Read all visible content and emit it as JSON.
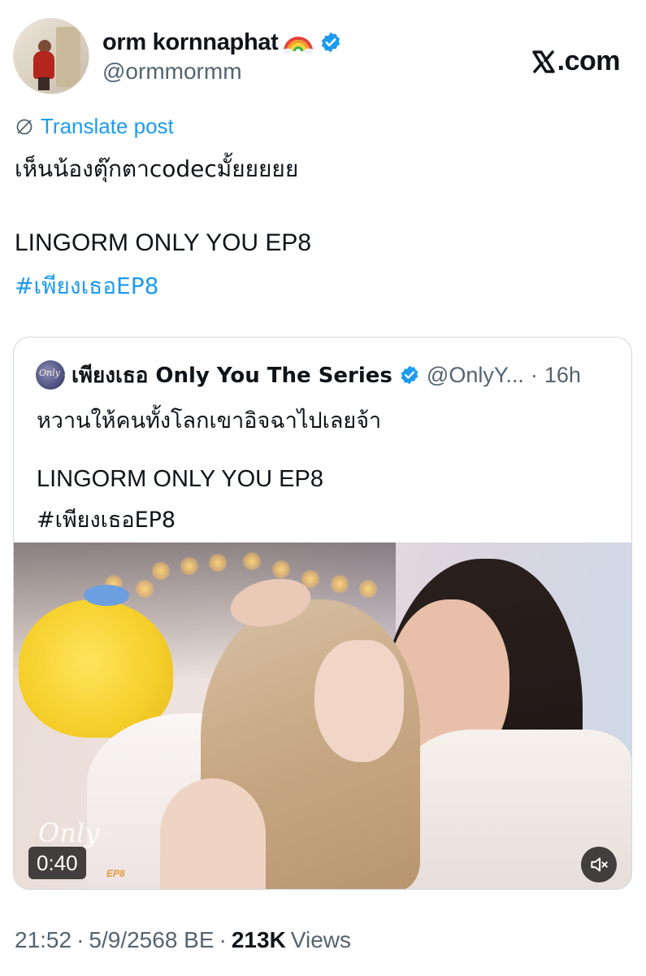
{
  "author": {
    "display_name": "orm kornnaphat",
    "handle": "@ormmormm",
    "emoji": "rainbow-flag",
    "verified": true
  },
  "brand": {
    "text": ".com",
    "logo": "x-logo-icon"
  },
  "translate": {
    "label": "Translate post",
    "icon": "globe-icon"
  },
  "post": {
    "line1": "เห็นน้องตุ๊กตาcodecมั้ยยยยย",
    "line2": "LINGORM ONLY YOU EP8",
    "hashtag": "#เพียงเธอEP8"
  },
  "quote": {
    "display_name": "เพียงเธอ Only You The Series",
    "handle": "@OnlyY...",
    "separator": "·",
    "time": "16h",
    "line1": "หวานให้คนทั้งโลกเขาอิจฉาไปเลยจ้า",
    "line2": "LINGORM ONLY YOU EP8",
    "hashtag": "#เพียงเธอEP8",
    "avatar_text": "Only You",
    "video": {
      "duration": "0:40",
      "watermark": "Only",
      "watermark_ep": "EP8",
      "mute_icon": "speaker-muted-icon"
    }
  },
  "meta": {
    "time": "21:52",
    "sep1": "·",
    "date": "5/9/2568 BE",
    "sep2": "·",
    "views_count": "213K",
    "views_label": "Views"
  },
  "colors": {
    "accent": "#1d9bf0",
    "text_primary": "#0f1419",
    "text_secondary": "#536471",
    "border": "#cfd9de"
  }
}
